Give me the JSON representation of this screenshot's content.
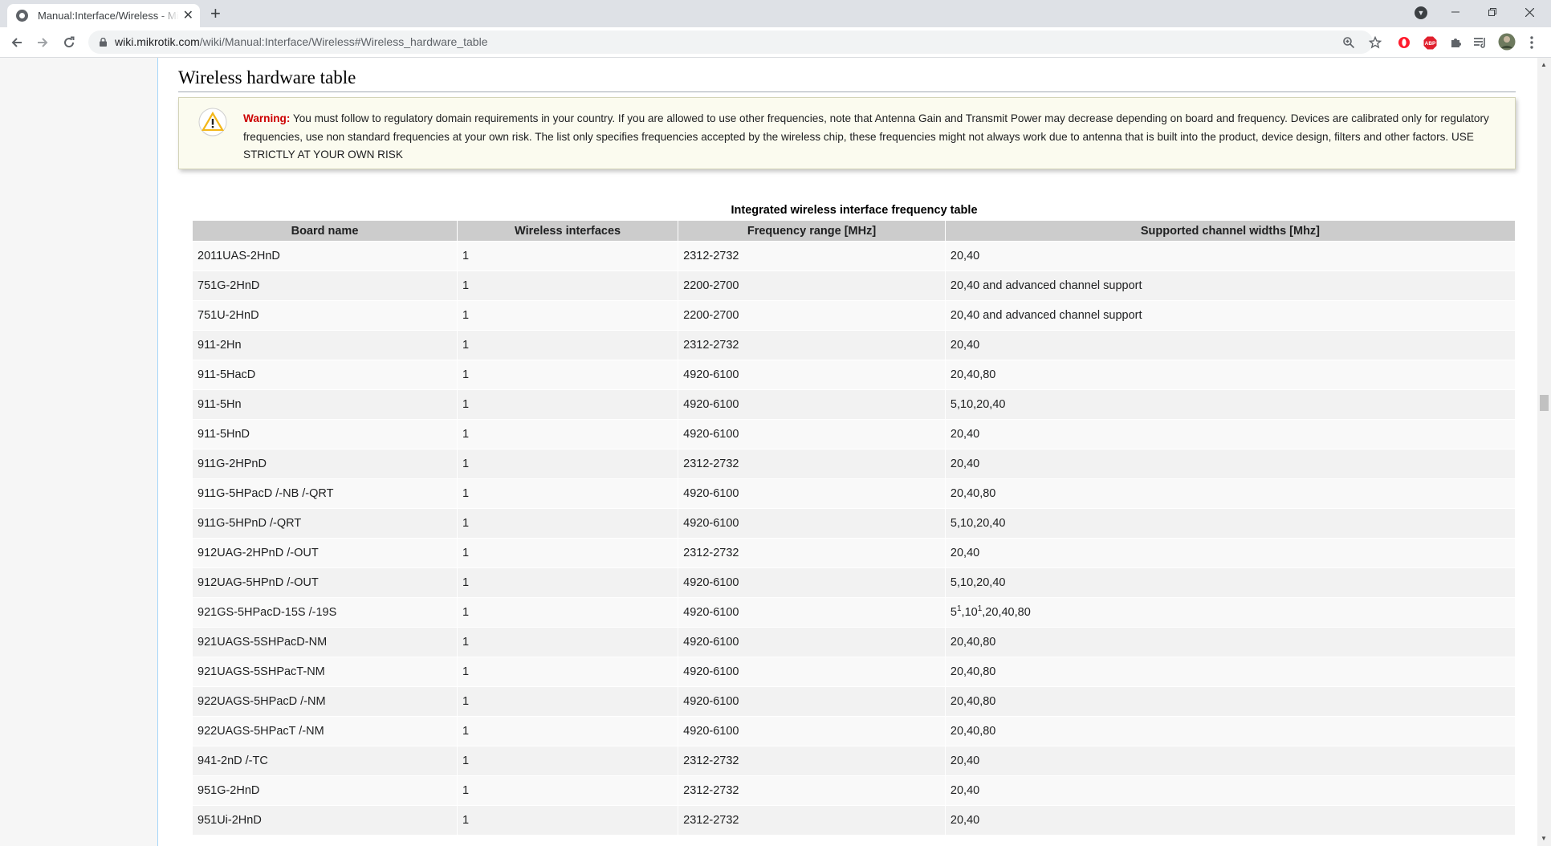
{
  "browser": {
    "tab_title": "Manual:Interface/Wireless - MikroTik Wiki",
    "new_tab": "+",
    "url_host": "wiki.mikrotik.com",
    "url_path": "/wiki/Manual:Interface/Wireless#Wireless_hardware_table",
    "icons": [
      "back-icon",
      "forward-icon",
      "reload-icon",
      "lock-icon",
      "zoom-icon",
      "star-icon",
      "opera-icon",
      "adblock-icon",
      "extensions-icon",
      "reading-list-icon",
      "avatar",
      "kebab-menu-icon"
    ],
    "adblock_label": "ABP"
  },
  "page": {
    "heading": "Wireless hardware table",
    "warning_label": "Warning:",
    "warning_text": "You must follow to regulatory domain requirements in your country. If you are allowed to use other frequencies, note that Antenna Gain and Transmit Power may decrease depending on board and frequency. Devices are calibrated only for regulatory frequencies, use non standard frequencies at your own risk. The list only specifies frequencies accepted by the wireless chip, these frequencies might not always work due to antenna that is built into the product, device design, filters and other factors. USE STRICTLY AT YOUR OWN RISK"
  },
  "table": {
    "caption": "Integrated wireless interface frequency table",
    "headers": [
      "Board name",
      "Wireless interfaces",
      "Frequency range [MHz]",
      "Supported channel widths [Mhz]"
    ],
    "rows": [
      {
        "board": "2011UAS-2HnD",
        "interfaces": "1",
        "range": "2312-2732",
        "widths": "20,40"
      },
      {
        "board": "751G-2HnD",
        "interfaces": "1",
        "range": "2200-2700",
        "widths": "20,40 and advanced channel support"
      },
      {
        "board": "751U-2HnD",
        "interfaces": "1",
        "range": "2200-2700",
        "widths": "20,40 and advanced channel support"
      },
      {
        "board": "911-2Hn",
        "interfaces": "1",
        "range": "2312-2732",
        "widths": "20,40"
      },
      {
        "board": "911-5HacD",
        "interfaces": "1",
        "range": "4920-6100",
        "widths": "20,40,80"
      },
      {
        "board": "911-5Hn",
        "interfaces": "1",
        "range": "4920-6100",
        "widths": "5,10,20,40"
      },
      {
        "board": "911-5HnD",
        "interfaces": "1",
        "range": "4920-6100",
        "widths": "20,40"
      },
      {
        "board": "911G-2HPnD",
        "interfaces": "1",
        "range": "2312-2732",
        "widths": "20,40"
      },
      {
        "board": "911G-5HPacD /-NB /-QRT",
        "interfaces": "1",
        "range": "4920-6100",
        "widths": "20,40,80"
      },
      {
        "board": "911G-5HPnD /-QRT",
        "interfaces": "1",
        "range": "4920-6100",
        "widths": "5,10,20,40"
      },
      {
        "board": "912UAG-2HPnD /-OUT",
        "interfaces": "1",
        "range": "2312-2732",
        "widths": "20,40"
      },
      {
        "board": "912UAG-5HPnD /-OUT",
        "interfaces": "1",
        "range": "4920-6100",
        "widths": "5,10,20,40"
      },
      {
        "board": "921GS-5HPacD-15S /-19S",
        "interfaces": "1",
        "range": "4920-6100",
        "widths": "5",
        "sup1": "1",
        "widths_mid": ",10",
        "sup2": "1",
        "widths_tail": ",20,40,80"
      },
      {
        "board": "921UAGS-5SHPacD-NM",
        "interfaces": "1",
        "range": "4920-6100",
        "widths": "20,40,80"
      },
      {
        "board": "921UAGS-5SHPacT-NM",
        "interfaces": "1",
        "range": "4920-6100",
        "widths": "20,40,80"
      },
      {
        "board": "922UAGS-5HPacD /-NM",
        "interfaces": "1",
        "range": "4920-6100",
        "widths": "20,40,80"
      },
      {
        "board": "922UAGS-5HPacT /-NM",
        "interfaces": "1",
        "range": "4920-6100",
        "widths": "20,40,80"
      },
      {
        "board": "941-2nD /-TC",
        "interfaces": "1",
        "range": "2312-2732",
        "widths": "20,40"
      },
      {
        "board": "951G-2HnD",
        "interfaces": "1",
        "range": "2312-2732",
        "widths": "20,40"
      },
      {
        "board": "951Ui-2HnD",
        "interfaces": "1",
        "range": "2312-2732",
        "widths": "20,40"
      }
    ]
  },
  "colors": {
    "warning_red": "#cc0000",
    "header_gray": "#cccccc",
    "warning_bg": "#fbfbef",
    "opera_red": "#ff1b2d"
  }
}
